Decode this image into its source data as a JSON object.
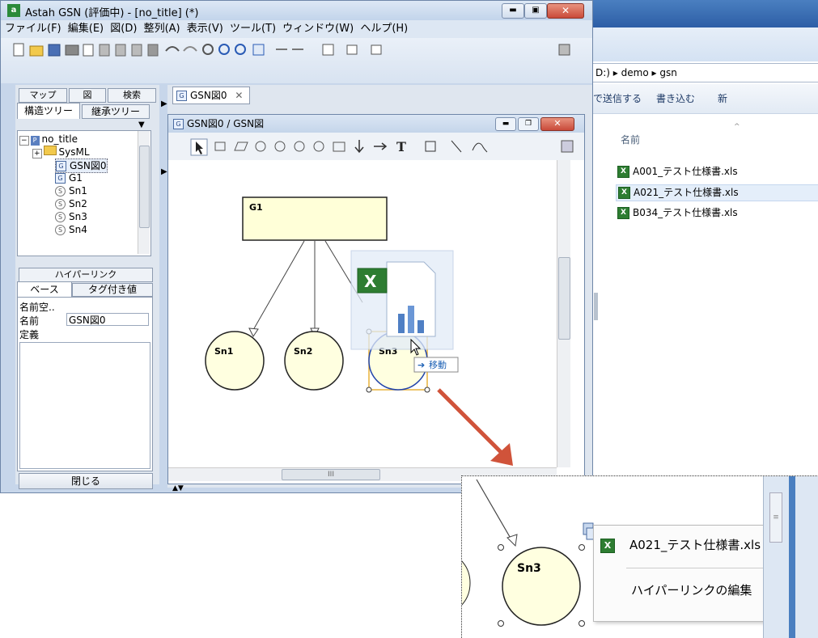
{
  "explorer": {
    "path_segments": [
      "D:)",
      "demo",
      "gsn"
    ],
    "toolbar": {
      "send_label": "で送信する",
      "burn_label": "書き込む",
      "new_label": "新"
    },
    "column_name": "名前",
    "files": [
      "A001_テスト仕様書.xls",
      "A021_テスト仕様書.xls",
      "B034_テスト仕様書.xls"
    ]
  },
  "app": {
    "title": "Astah GSN (評価中) - [no_title] (*)",
    "menu": [
      "ファイル(F)",
      "編集(E)",
      "図(D)",
      "整列(A)",
      "表示(V)",
      "ツール(T)",
      "ウィンドウ(W)",
      "ヘルプ(H)"
    ]
  },
  "left_panel": {
    "tabs_row1": [
      "マップ",
      "図",
      "検索"
    ],
    "tabs_row2": [
      "構造ツリー",
      "継承ツリー"
    ],
    "tree": [
      {
        "label": "no_title",
        "icon": "project-icon"
      },
      {
        "label": "SysML",
        "icon": "folder-icon"
      },
      {
        "label": "GSN図0",
        "icon": "gsn-diagram-icon"
      },
      {
        "label": "G1",
        "icon": "goal-icon"
      },
      {
        "label": "Sn1",
        "icon": "solution-icon"
      },
      {
        "label": "Sn2",
        "icon": "solution-icon"
      },
      {
        "label": "Sn3",
        "icon": "solution-icon"
      },
      {
        "label": "Sn4",
        "icon": "solution-icon"
      }
    ],
    "prop_tabs_row1": [
      "ハイパーリンク"
    ],
    "prop_tabs_row2": [
      "ベース",
      "タグ付き値"
    ],
    "props": {
      "namespace_label": "名前空..",
      "name_label": "名前",
      "name_value": "GSN図0",
      "definition_label": "定義"
    },
    "close_button": "閉じる"
  },
  "editor": {
    "doc_tab": "GSN図0",
    "inner_title": "GSN図0 / GSN図",
    "scroll_marker": "III",
    "nodes": {
      "goal": "G1",
      "sn1": "Sn1",
      "sn2": "Sn2",
      "sn3": "Sn3"
    },
    "drag_tooltip": "移動"
  },
  "zoom": {
    "node_label": "Sn3",
    "menu": {
      "link_item": "A021_テスト仕様書.xls",
      "edit_item": "ハイパーリンクの編集"
    }
  },
  "colors": {
    "title_bar": "#c9d9ee",
    "node_fill": "#ffffe0",
    "goal_fill": "#ffffd8",
    "callout_arrow": "#d0533a",
    "excel_green": "#2e7d32",
    "close_red": "#c94a3a"
  }
}
